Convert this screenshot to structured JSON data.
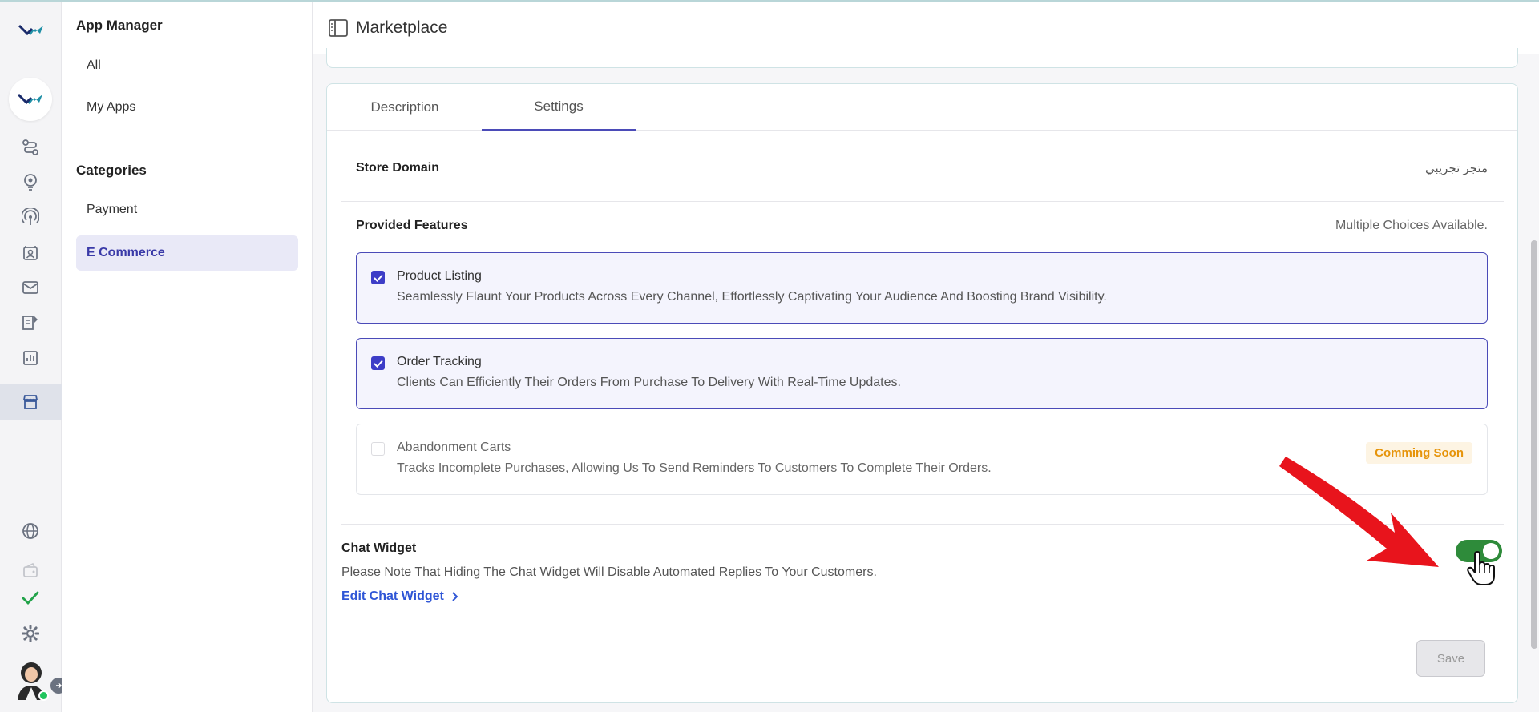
{
  "sidebar": {
    "title": "App Manager",
    "items": [
      {
        "label": "All"
      },
      {
        "label": "My Apps"
      }
    ],
    "categories_title": "Categories",
    "categories": [
      {
        "label": "Payment"
      },
      {
        "label": "E Commerce"
      }
    ]
  },
  "header": {
    "title": "Marketplace"
  },
  "tabs": [
    {
      "label": "Description"
    },
    {
      "label": "Settings"
    }
  ],
  "store": {
    "label": "Store Domain",
    "value": "متجر تجريبي"
  },
  "features": {
    "label": "Provided Features",
    "hint": "Multiple Choices Available.",
    "items": [
      {
        "title": "Product Listing",
        "desc": "Seamlessly Flaunt Your Products Across Every Channel, Effortlessly Captivating Your Audience And Boosting Brand Visibility.",
        "checked": true
      },
      {
        "title": "Order Tracking",
        "desc": "Clients Can Efficiently Their Orders From Purchase To Delivery With Real-Time Updates.",
        "checked": true
      },
      {
        "title": "Abandonment Carts",
        "desc": "Tracks Incomplete Purchases, Allowing Us To Send Reminders To Customers To Complete Their Orders.",
        "checked": false,
        "badge": "Comming Soon"
      }
    ]
  },
  "chat": {
    "title": "Chat Widget",
    "desc": "Please Note That Hiding The Chat Widget Will Disable Automated Replies To Your Customers.",
    "link": "Edit Chat Widget",
    "enabled": true
  },
  "save_label": "Save",
  "colors": {
    "accent": "#4b4bb8",
    "toggle_on": "#2e8b3a",
    "link": "#2f56d6",
    "badge": "#e6940a",
    "annotation_arrow": "#e8141c"
  }
}
